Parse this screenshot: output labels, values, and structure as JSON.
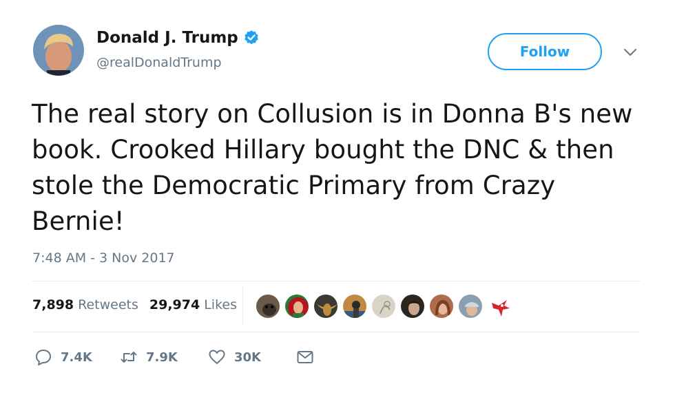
{
  "author": {
    "name": "Donald J. Trump",
    "handle": "@realDonaldTrump",
    "verified": true
  },
  "follow_label": "Follow",
  "tweet": {
    "text": "The real story on Collusion is in Donna B's new book. Crooked Hillary bought the DNC & then stole the Democratic Primary from Crazy Bernie!",
    "timestamp": "7:48 AM - 3 Nov 2017"
  },
  "stats": {
    "retweets_count": "7,898",
    "retweets_label": "Retweets",
    "likes_count": "29,974",
    "likes_label": "Likes"
  },
  "liker_avatars": [
    {
      "icon": "dog-avatar",
      "color": "#6b5a4a"
    },
    {
      "icon": "cartoon-avatar",
      "color": "#2a7a3a"
    },
    {
      "icon": "longhorn-avatar",
      "color": "#3a3a33"
    },
    {
      "icon": "person-avatar",
      "color": "#c08a40"
    },
    {
      "icon": "sketch-avatar",
      "color": "#d8d4c6"
    },
    {
      "icon": "person-avatar",
      "color": "#2c2620"
    },
    {
      "icon": "person-avatar",
      "color": "#b06a4c"
    },
    {
      "icon": "person-avatar",
      "color": "#8aa0b0"
    },
    {
      "icon": "mascot-avatar",
      "color": "#d9262c"
    }
  ],
  "actions": {
    "reply_count": "7.4K",
    "retweet_count": "7.9K",
    "like_count": "30K"
  },
  "colors": {
    "accent": "#1da1f2",
    "secondary_text": "#657786",
    "divider": "#e6ecf0"
  }
}
